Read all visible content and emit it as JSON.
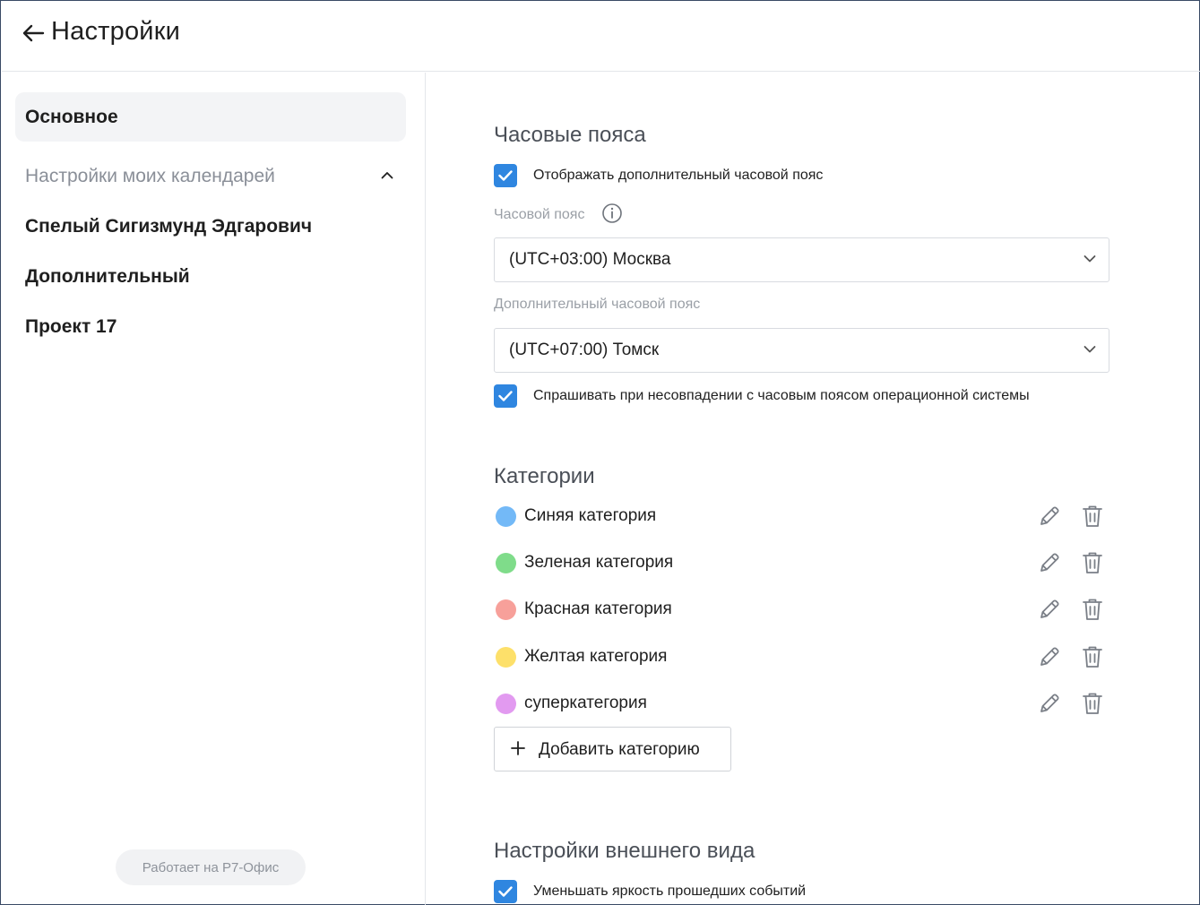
{
  "header": {
    "title": "Настройки",
    "back_icon": "arrow-left-icon"
  },
  "sidebar": {
    "active_item": "Основное",
    "group_label": "Настройки моих календарей",
    "group_icon": "chevron-up-icon",
    "items": [
      {
        "label": "Спелый Сигизмунд Эдгарович"
      },
      {
        "label": "Дополнительный"
      },
      {
        "label": "Проект 17"
      }
    ],
    "powered_by": "Работает на Р7-Офис"
  },
  "timezones": {
    "title": "Часовые пояса",
    "show_additional": {
      "label": "Отображать дополнительный часовой пояс",
      "checked": true
    },
    "timezone_label": "Часовой пояс",
    "timezone_value": "(UTC+03:00) Москва",
    "additional_label": "Дополнительный часовой пояс",
    "additional_value": "(UTC+07:00) Томск",
    "ask_mismatch": {
      "label": "Спрашивать при несовпадении с часовым поясом операционной системы",
      "checked": true
    }
  },
  "categories": {
    "title": "Категории",
    "items": [
      {
        "name": "Синяя категория",
        "color": "#73b9f7"
      },
      {
        "name": "Зеленая категория",
        "color": "#7fdc8a"
      },
      {
        "name": "Красная категория",
        "color": "#f7a09a"
      },
      {
        "name": "Желтая категория",
        "color": "#fde06a"
      },
      {
        "name": "суперкатегория",
        "color": "#e29af0"
      }
    ],
    "add_label": "Добавить категорию"
  },
  "appearance": {
    "title": "Настройки внешнего вида",
    "dim_past": {
      "label": "Уменьшать яркость прошедших событий",
      "checked": true
    }
  },
  "colors": {
    "accent": "#2f86e0",
    "icon_gray": "#7a7f87"
  }
}
